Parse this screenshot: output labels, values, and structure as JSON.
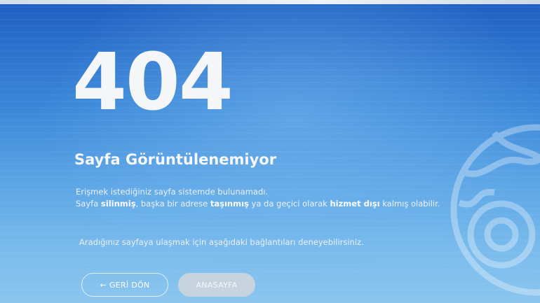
{
  "error": {
    "code": "404",
    "title": "Sayfa Görüntülenemiyor",
    "line1": "Erişmek istediğiniz sayfa sistemde bulunamadı.",
    "line2": {
      "part1": "Sayfa ",
      "bold1": "silinmiş",
      "part2": ", başka bir adrese ",
      "bold2": "taşınmış",
      "part3": " ya da geçici olarak ",
      "bold3": "hizmet dışı",
      "part4": " kalmış olabilir."
    },
    "hint": "Aradığınız sayfaya ulaşmak için aşağıdaki bağlantıları deneyebilirsiniz."
  },
  "buttons": {
    "back_label": "← GERİ DÖN",
    "home_label": "ANASAYFA"
  },
  "icons": {
    "decoration": "gear-globe-icon"
  },
  "colors": {
    "background_top": "#1f5fc2",
    "background_bottom": "#8ac5ee",
    "text": "#f4f6f8",
    "home_button": "#c6d3de"
  }
}
